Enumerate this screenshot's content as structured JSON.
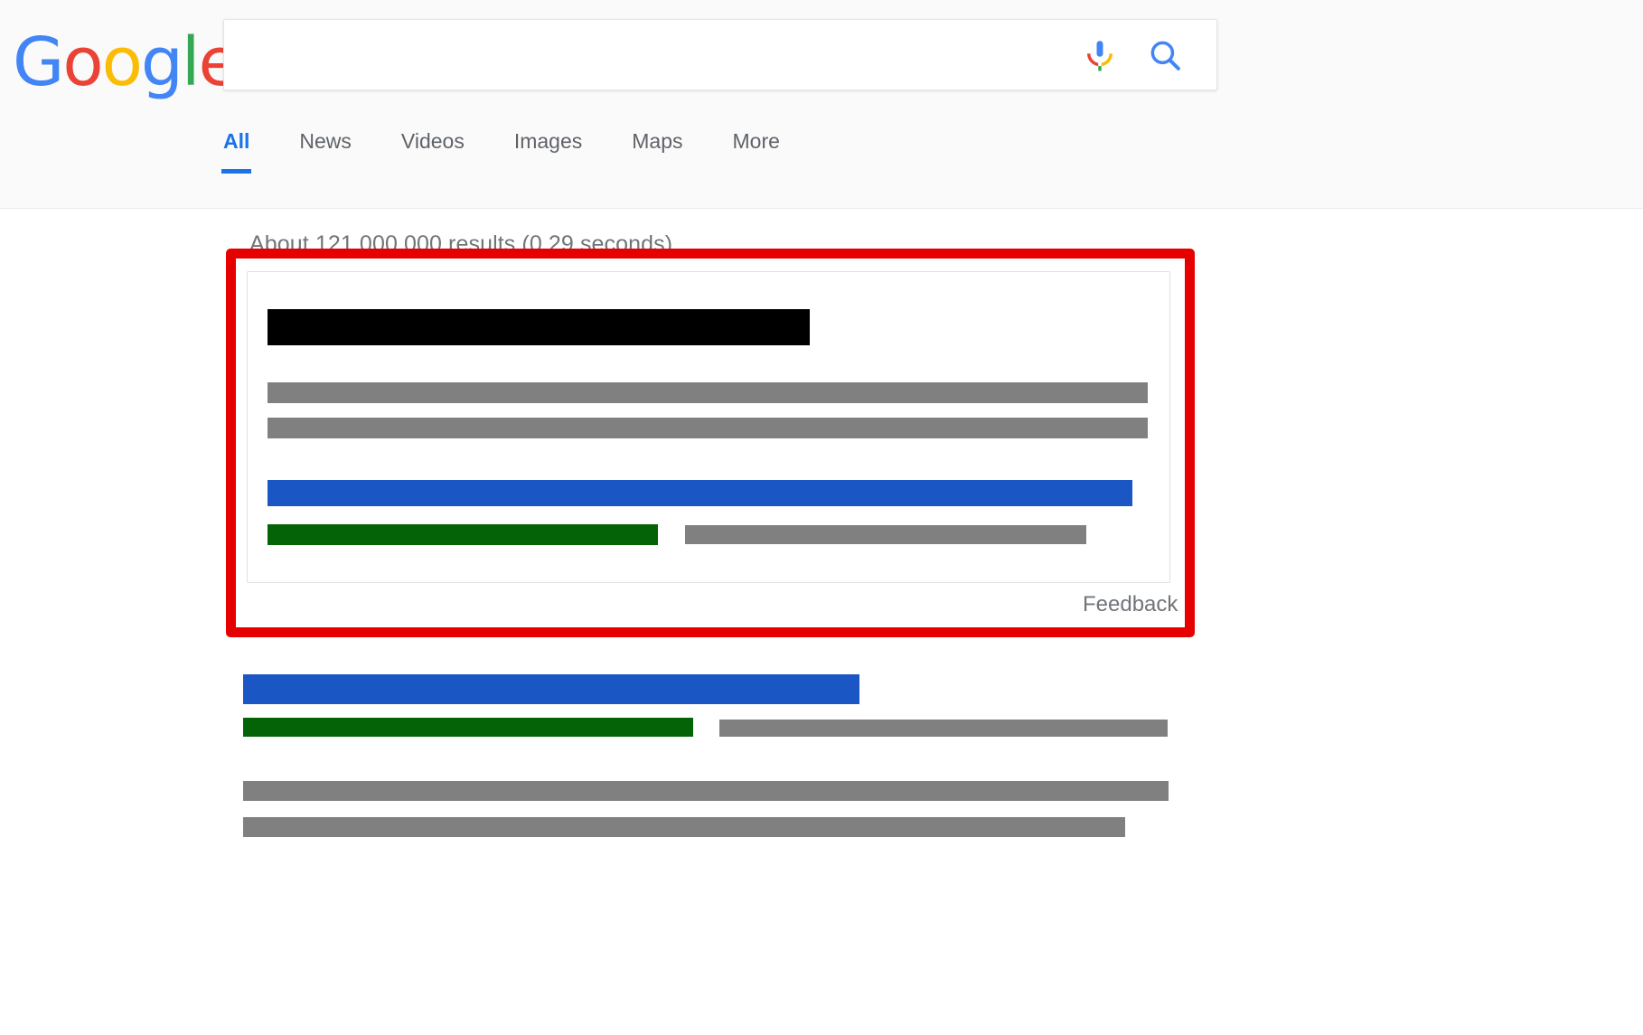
{
  "browser": {
    "page_background": "#ffffff"
  },
  "header": {
    "logo": {
      "name": "Google",
      "letters": [
        {
          "char": "G",
          "color": "#4285F4"
        },
        {
          "char": "o",
          "color": "#EA4335"
        },
        {
          "char": "o",
          "color": "#FBBC05"
        },
        {
          "char": "g",
          "color": "#4285F4"
        },
        {
          "char": "l",
          "color": "#34A853"
        },
        {
          "char": "e",
          "color": "#EA4335"
        }
      ]
    },
    "search": {
      "value": "",
      "placeholder": "",
      "mic_icon": "microphone-icon",
      "search_icon": "search-icon"
    },
    "tabs": [
      {
        "label": "All",
        "active": true
      },
      {
        "label": "News",
        "active": false
      },
      {
        "label": "Videos",
        "active": false
      },
      {
        "label": "Images",
        "active": false
      },
      {
        "label": "Maps",
        "active": false
      },
      {
        "label": "More",
        "active": false
      }
    ]
  },
  "results": {
    "stats": "About 121,000,000 results (0.29 seconds)",
    "feedback_label": "Feedback",
    "annotation": {
      "color": "#e60000",
      "shape": "rectangle-outline"
    },
    "knowledge_card": {
      "redacted": true,
      "bars": [
        {
          "name": "title",
          "color": "#000000"
        },
        {
          "name": "snippet-line-1",
          "color": "#808080"
        },
        {
          "name": "snippet-line-2",
          "color": "#808080"
        },
        {
          "name": "result-title",
          "color": "#1a56c4"
        },
        {
          "name": "result-url",
          "color": "#046307"
        },
        {
          "name": "result-meta",
          "color": "#808080"
        }
      ]
    },
    "organic_result": {
      "redacted": true,
      "bars": [
        {
          "name": "title",
          "color": "#1a56c4"
        },
        {
          "name": "url",
          "color": "#046307"
        },
        {
          "name": "meta",
          "color": "#808080"
        },
        {
          "name": "snippet-line-1",
          "color": "#808080"
        },
        {
          "name": "snippet-line-2",
          "color": "#808080"
        }
      ]
    }
  },
  "colors": {
    "google_blue": "#4285F4",
    "google_red": "#EA4335",
    "google_yellow": "#FBBC05",
    "google_green": "#34A853",
    "link_blue": "#1a73e8",
    "text_gray": "#70757a",
    "annotation_red": "#e60000",
    "redact_black": "#000000",
    "redact_gray": "#808080",
    "redact_blue": "#1a56c4",
    "redact_green": "#046307"
  }
}
